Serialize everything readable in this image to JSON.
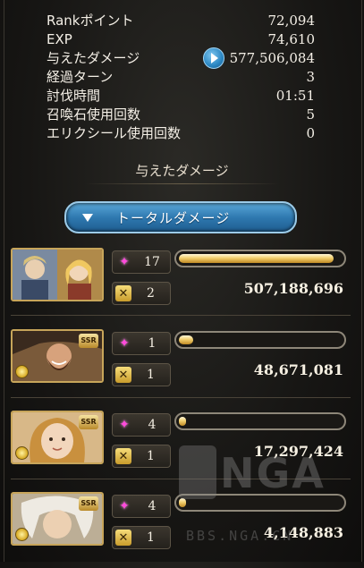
{
  "stats": [
    {
      "label": "Rankポイント",
      "value": "72,094"
    },
    {
      "label": "EXP",
      "value": "74,610"
    },
    {
      "label": "与えたダメージ",
      "value": "577,506,084"
    },
    {
      "label": "経過ターン",
      "value": "3"
    },
    {
      "label": "討伐時間",
      "value": "01:51"
    },
    {
      "label": "召喚石使用回数",
      "value": "5"
    },
    {
      "label": "エリクシール使用回数",
      "value": "0"
    }
  ],
  "section_title": "与えたダメージ",
  "dropdown": {
    "label": "トータルダメージ"
  },
  "characters": [
    {
      "portrait": "duo-portrait",
      "stars": "17",
      "crosses": "2",
      "damage": "507,188,696",
      "fill": 0.95,
      "rarity": ""
    },
    {
      "portrait": "bearded-warrior",
      "stars": "1",
      "crosses": "1",
      "damage": "48,671,081",
      "fill": 0.09,
      "rarity": "SSR"
    },
    {
      "portrait": "blonde-girl",
      "stars": "4",
      "crosses": "1",
      "damage": "17,297,424",
      "fill": 0.03,
      "rarity": "SSR"
    },
    {
      "portrait": "white-hair",
      "stars": "4",
      "crosses": "1",
      "damage": "4,148,883",
      "fill": 0.01,
      "rarity": "SSR"
    }
  ],
  "watermark": {
    "brand": "NGA",
    "url": "BBS.NGA.CN"
  },
  "colors": {
    "gold": "#c7a55a",
    "star": "#ff4bdc",
    "blue": "#2f79b0"
  }
}
